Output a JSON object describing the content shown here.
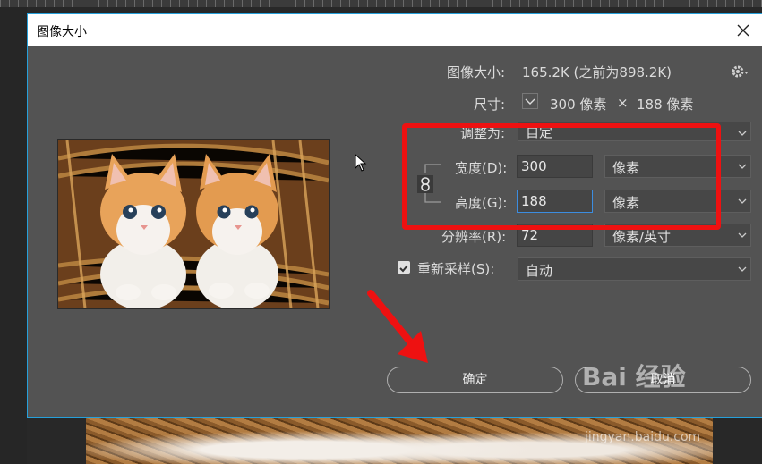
{
  "dialog": {
    "title": "图像大小",
    "image_size_label": "图像大小:",
    "image_size_value": "165.2K (之前为898.2K)",
    "dimensions_label": "尺寸:",
    "dimensions_width": "300 像素",
    "dimensions_times": "×",
    "dimensions_height": "188 像素",
    "fit_to_label": "调整为:",
    "fit_to_value": "自定",
    "width_label": "宽度(D):",
    "width_value": "300",
    "width_unit": "像素",
    "height_label": "高度(G):",
    "height_value": "188",
    "height_unit": "像素",
    "resolution_label": "分辨率(R):",
    "resolution_value": "72",
    "resolution_unit": "像素/英寸",
    "resample_label": "重新采样(S):",
    "resample_value": "自动",
    "ok_label": "确定",
    "cancel_label": "取消"
  },
  "watermark": {
    "brand": "Bai 经验",
    "url": "jingyan.baidu.com"
  },
  "colors": {
    "dialog_bg": "#535353",
    "highlight_red": "#ee1111",
    "accent_blue": "#3c8de0"
  }
}
